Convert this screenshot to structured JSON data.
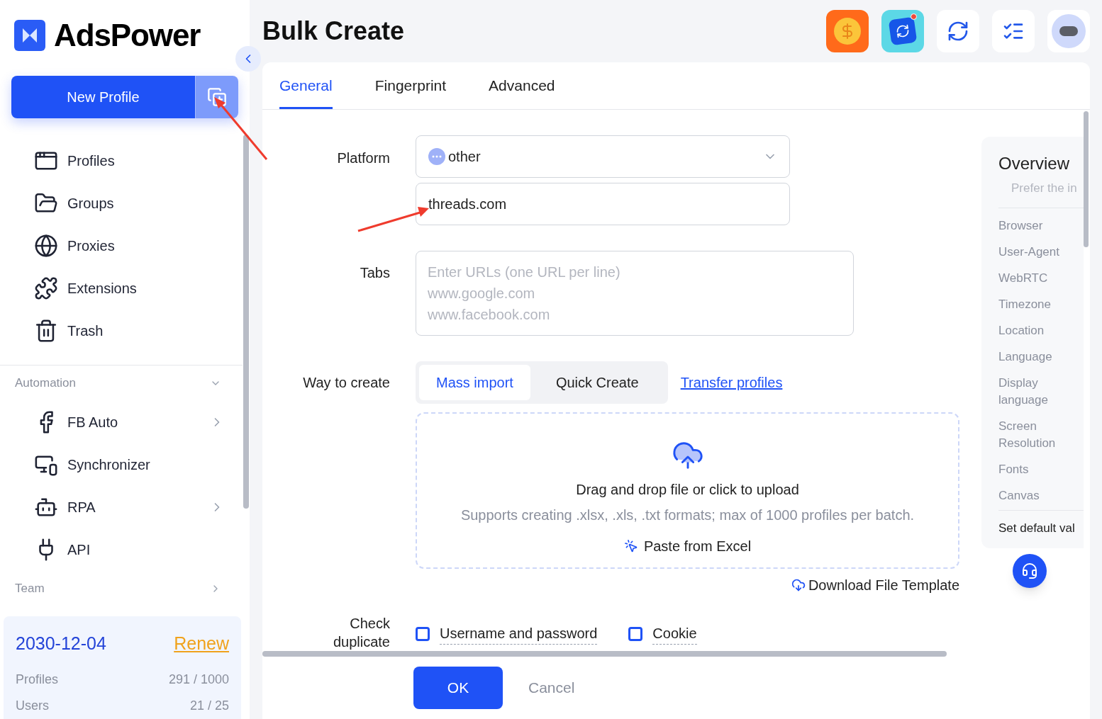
{
  "app": {
    "name": "AdsPower"
  },
  "sidebar": {
    "new_profile": "New Profile",
    "nav_items": [
      {
        "label": "Profiles",
        "kind": "profiles"
      },
      {
        "label": "Groups",
        "kind": "groups"
      },
      {
        "label": "Proxies",
        "kind": "proxies"
      },
      {
        "label": "Extensions",
        "kind": "extensions"
      },
      {
        "label": "Trash",
        "kind": "trash"
      }
    ],
    "sections": [
      {
        "title": "Automation",
        "expanded": true,
        "items": [
          {
            "label": "FB Auto",
            "kind": "fb",
            "submenu": true
          },
          {
            "label": "Synchronizer",
            "kind": "sync",
            "submenu": false
          },
          {
            "label": "RPA",
            "kind": "rpa",
            "submenu": true
          },
          {
            "label": "API",
            "kind": "api",
            "submenu": false
          }
        ]
      },
      {
        "title": "Team",
        "expanded": false
      }
    ]
  },
  "subscription": {
    "expiry": "2030-12-04",
    "renew": "Renew",
    "stats": [
      {
        "label": "Profiles",
        "value": "291 / 1000"
      },
      {
        "label": "Users",
        "value": "21 / 25"
      }
    ]
  },
  "page": {
    "title": "Bulk Create"
  },
  "tabs": [
    {
      "label": "General",
      "selected": true
    },
    {
      "label": "Fingerprint",
      "selected": false
    },
    {
      "label": "Advanced",
      "selected": false
    }
  ],
  "form": {
    "platform": {
      "label": "Platform",
      "value": "other",
      "url": "threads.com"
    },
    "tabs_field": {
      "label": "Tabs",
      "placeholder": "Enter URLs (one URL per line)\nwww.google.com\nwww.facebook.com"
    },
    "way": {
      "label": "Way to create",
      "options": [
        {
          "label": "Mass import",
          "selected": true
        },
        {
          "label": "Quick Create",
          "selected": false
        }
      ],
      "link": "Transfer profiles"
    },
    "upload": {
      "title": "Drag and drop file or click to upload",
      "hint": "Supports creating .xlsx, .xls, .txt formats; max of 1000 profiles per batch.",
      "paste": "Paste from Excel"
    },
    "download": "Download File Template",
    "check_duplicate": {
      "label": "Check duplicate",
      "options": [
        {
          "label": "Username and password",
          "checked": false
        },
        {
          "label": "Cookie",
          "checked": false
        }
      ]
    }
  },
  "overview": {
    "title": "Overview",
    "subtitle": "Prefer the in",
    "items": [
      "Browser",
      "User-Agent",
      "WebRTC",
      "Timezone",
      "Location",
      "Language",
      "Display language",
      "Screen Resolution",
      "Fonts",
      "Canvas"
    ],
    "footer": "Set default val"
  },
  "actions": {
    "ok": "OK",
    "cancel": "Cancel"
  }
}
